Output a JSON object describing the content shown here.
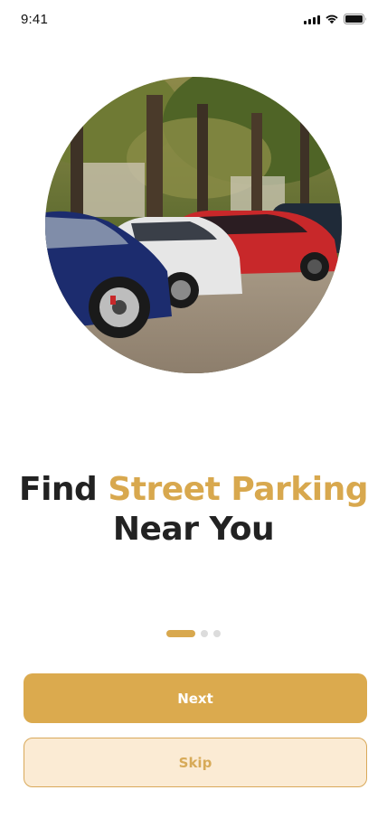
{
  "status_bar": {
    "time": "9:41",
    "icons": [
      "cellular-signal-icon",
      "wifi-icon",
      "battery-icon"
    ]
  },
  "hero": {
    "image": "parked-cars-street-photo"
  },
  "headline": {
    "prefix": "Find ",
    "accent": "Street Parking",
    "line2": "Near You"
  },
  "pagination": {
    "total": 3,
    "active_index": 0
  },
  "buttons": {
    "next_label": "Next",
    "skip_label": "Skip"
  },
  "colors": {
    "accent": "#d8a84e",
    "skip_background": "#fbebd4",
    "text": "#222222"
  }
}
